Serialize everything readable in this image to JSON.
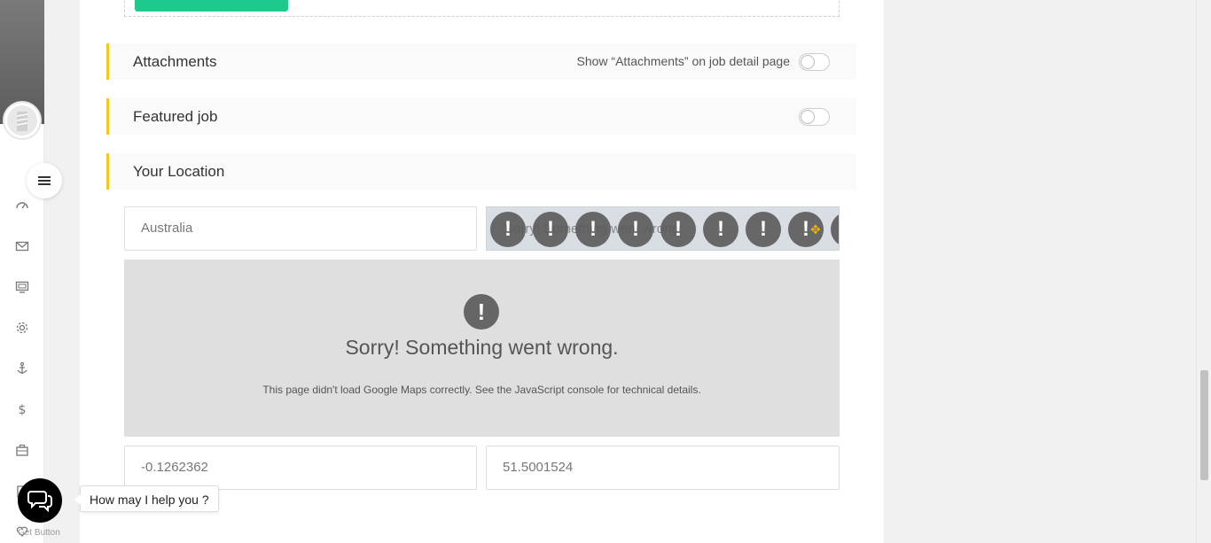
{
  "sections": {
    "attachments": {
      "title": "Attachments",
      "note": "Show “Attachments” on job detail page"
    },
    "featured": {
      "title": "Featured job"
    },
    "location": {
      "title": "Your Location"
    }
  },
  "location": {
    "country_value": "Australia",
    "map_search_error": "Sorry! Something went wrong.",
    "longitude_value": "-0.1262362",
    "latitude_value": "51.5001524"
  },
  "map": {
    "error_icon": "!",
    "error_title": "Sorry! Something went wrong.",
    "error_desc": "This page didn't load Google Maps correctly. See the JavaScript console for technical details."
  },
  "chat": {
    "bubble_text": "How may I help you ?",
    "getbutton_label": "Get Button"
  },
  "colors": {
    "accent_bar": "#f4c81e",
    "green_button": "#1ec98c"
  },
  "icons": [
    "logo",
    "menu-icon",
    "dashboard-icon",
    "mail-icon",
    "monitor-icon",
    "gear-icon",
    "anchor-icon",
    "dollar-icon",
    "briefcase-icon",
    "chat-icon"
  ]
}
